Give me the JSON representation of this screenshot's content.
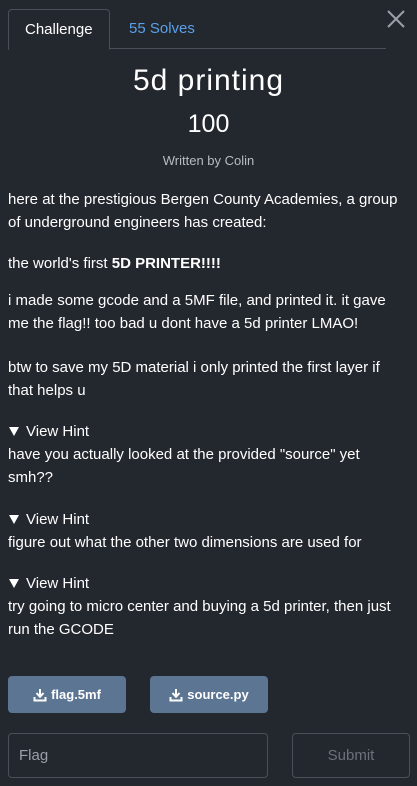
{
  "tabs": [
    {
      "label": "Challenge",
      "active": true
    },
    {
      "label": "55 Solves",
      "active": false
    }
  ],
  "challenge": {
    "name": "5d printing",
    "points": "100",
    "author": "Written by Colin"
  },
  "description": {
    "p1": "here at the prestigious Bergen County Academies, a group of underground engineers has created:",
    "p2_prefix": "the world's first ",
    "p2_bold": "5D PRINTER!!!!",
    "p3": "i made some gcode and a 5MF file, and printed it. it gave me the flag!! too bad u dont have a 5d printer LMAO!",
    "p4": "btw to save my 5D material i only printed the first layer if that helps u"
  },
  "hints": [
    {
      "toggle": "View Hint",
      "text": "have you actually looked at the provided \"source\" yet smh??"
    },
    {
      "toggle": "View Hint",
      "text": "figure out what the other two dimensions are used for"
    },
    {
      "toggle": "View Hint",
      "text": "try going to micro center and buying a 5d printer, then just run the GCODE"
    }
  ],
  "files": [
    {
      "name": "flag.5mf",
      "icon": "download-icon"
    },
    {
      "name": "source.py",
      "icon": "download-icon"
    }
  ],
  "flag_input": {
    "placeholder": "Flag",
    "value": ""
  },
  "submit_label": "Submit",
  "colors": {
    "background": "#23272e",
    "accent_link": "#5aa0e8",
    "file_button": "#5b7593",
    "border": "#4b5058"
  }
}
